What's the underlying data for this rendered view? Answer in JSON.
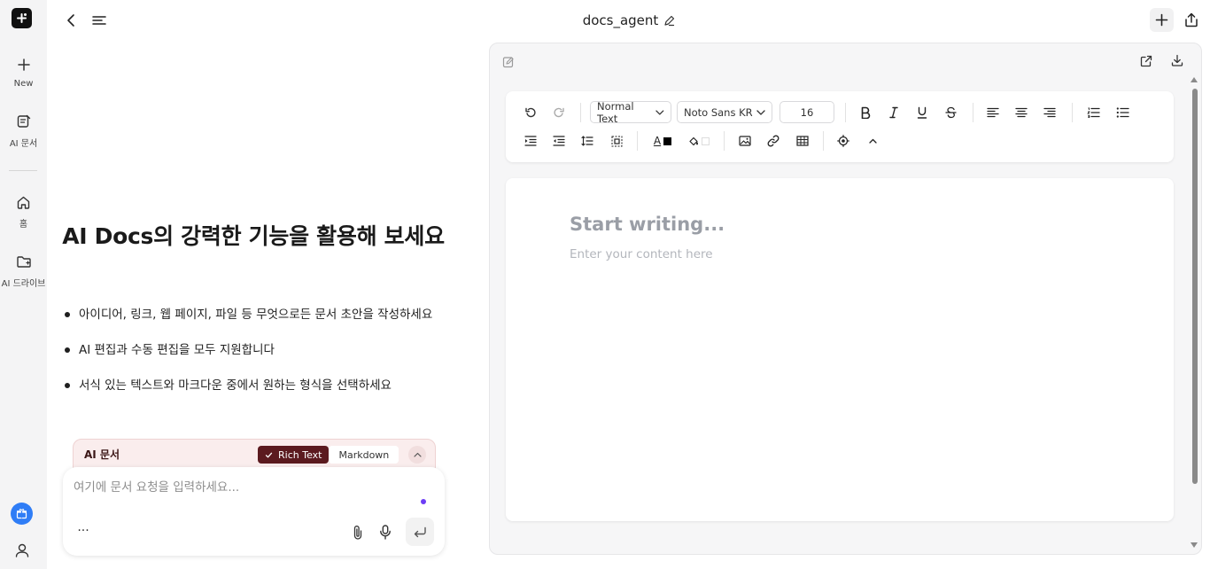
{
  "rail": {
    "new_label": "New",
    "ai_docs_label": "AI 문서",
    "home_label": "홈",
    "ai_drive_label": "AI 드라이브"
  },
  "header": {
    "title": "docs_agent"
  },
  "hero": {
    "title": "AI Docs의 강력한 기능을 활용해 보세요"
  },
  "features": [
    "아이디어, 링크, 웹 페이지, 파일 등 무엇으로든 문서 초안을 작성하세요",
    "AI 편집과 수동 편집을 모두 지원합니다",
    "서식 있는 텍스트와 마크다운 중에서 원하는 형식을 선택하세요"
  ],
  "aidoc": {
    "title": "AI 문서",
    "rich_text_label": "Rich Text",
    "markdown_label": "Markdown"
  },
  "composer": {
    "placeholder": "여기에 문서 요청을 입력하세요...",
    "more_label": "···"
  },
  "toolbar": {
    "block_style": "Normal Text",
    "font_family": "Noto Sans KR",
    "font_size": "16",
    "text_color_glyph": "A"
  },
  "editor": {
    "placeholder_title": "Start writing...",
    "placeholder_body": "Enter your content here"
  },
  "colors": {
    "accent_dark_red": "#5b1a1f",
    "card_pink": "#faeded",
    "gift_blue": "#2f7df6",
    "dot_purple": "#6d3df5"
  }
}
